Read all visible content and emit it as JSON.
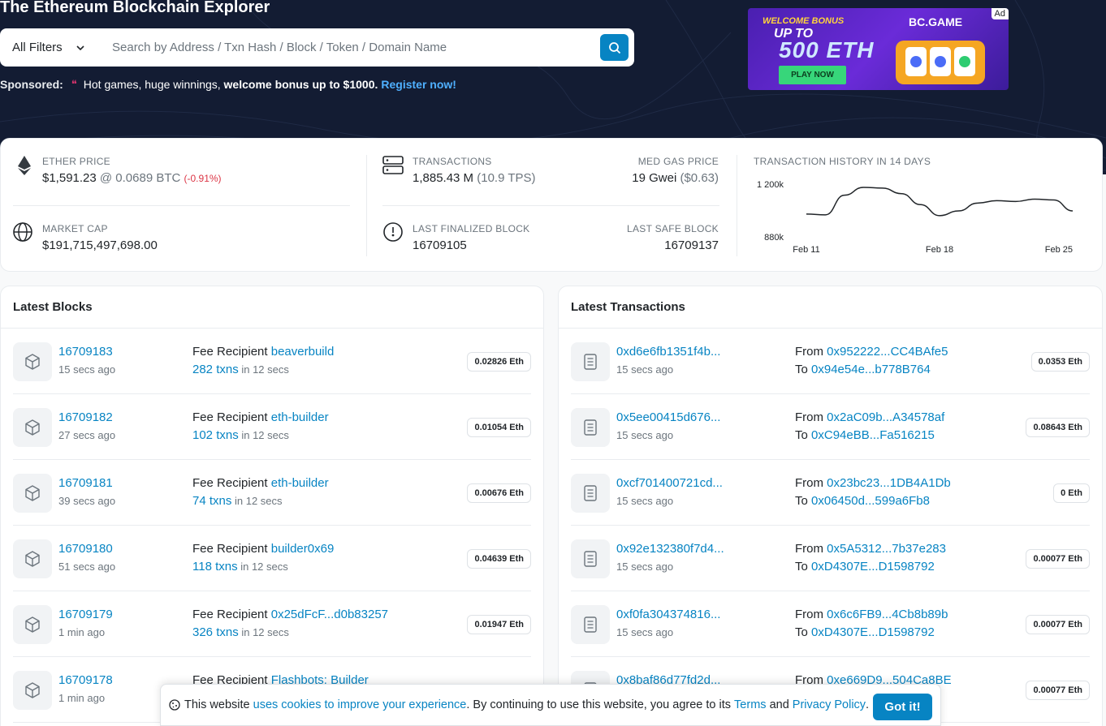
{
  "header": {
    "title": "The Ethereum Blockchain Explorer"
  },
  "search": {
    "filter_label": "All Filters",
    "placeholder": "Search by Address / Txn Hash / Block / Token / Domain Name"
  },
  "sponsored": {
    "label": "Sponsored:",
    "text": "Hot games, huge winnings,",
    "bold": "welcome bonus up to $1000.",
    "link": "Register now!"
  },
  "ad": {
    "line1": "WELCOME BONUS",
    "line2": "UP TO",
    "line3": "500 ETH",
    "cta": "PLAY NOW",
    "brand": "BC.GAME",
    "tag": "Ad"
  },
  "stats": {
    "ether_price": {
      "label": "ETHER PRICE",
      "usd": "$1,591.23",
      "sep": " @ ",
      "btc": "0.0689 BTC",
      "change": "(-0.91%)"
    },
    "market_cap": {
      "label": "MARKET CAP",
      "value": "$191,715,497,698.00"
    },
    "transactions": {
      "label": "TRANSACTIONS",
      "value": "1,885.43 M",
      "tps": "(10.9 TPS)"
    },
    "med_gas": {
      "label": "MED GAS PRICE",
      "value": "19 Gwei",
      "usd": "($0.63)"
    },
    "last_finalized": {
      "label": "LAST FINALIZED BLOCK",
      "value": "16709105"
    },
    "last_safe": {
      "label": "LAST SAFE BLOCK",
      "value": "16709137"
    },
    "history": {
      "label": "TRANSACTION HISTORY IN 14 DAYS"
    }
  },
  "chart_data": {
    "type": "line",
    "title": "TRANSACTION HISTORY IN 14 DAYS",
    "x": [
      "Feb 11",
      "Feb 12",
      "Feb 13",
      "Feb 14",
      "Feb 15",
      "Feb 16",
      "Feb 17",
      "Feb 18",
      "Feb 19",
      "Feb 20",
      "Feb 21",
      "Feb 22",
      "Feb 23",
      "Feb 24",
      "Feb 25"
    ],
    "values": [
      1020,
      1015,
      1140,
      1190,
      1185,
      1150,
      1080,
      1010,
      1040,
      1090,
      1105,
      1100,
      1115,
      1110,
      1040
    ],
    "ytick_labels": [
      "1 200k",
      "880k"
    ],
    "ylim": [
      880,
      1200
    ],
    "xtick_labels": [
      "Feb 11",
      "Feb 18",
      "Feb 25"
    ],
    "grid": false
  },
  "latest_blocks": {
    "title": "Latest Blocks",
    "fee_label": "Fee Recipient",
    "rows": [
      {
        "block": "16709183",
        "age": "15 secs ago",
        "recipient": "beaverbuild",
        "txns": "282 txns",
        "time": "in 12 secs",
        "reward": "0.02826 Eth"
      },
      {
        "block": "16709182",
        "age": "27 secs ago",
        "recipient": "eth-builder",
        "txns": "102 txns",
        "time": "in 12 secs",
        "reward": "0.01054 Eth"
      },
      {
        "block": "16709181",
        "age": "39 secs ago",
        "recipient": "eth-builder",
        "txns": "74 txns",
        "time": "in 12 secs",
        "reward": "0.00676 Eth"
      },
      {
        "block": "16709180",
        "age": "51 secs ago",
        "recipient": "builder0x69",
        "txns": "118 txns",
        "time": "in 12 secs",
        "reward": "0.04639 Eth"
      },
      {
        "block": "16709179",
        "age": "1 min ago",
        "recipient": "0x25dFcF...d0b83257",
        "txns": "326 txns",
        "time": "in 12 secs",
        "reward": "0.01947 Eth"
      },
      {
        "block": "16709178",
        "age": "1 min ago",
        "recipient": "Flashbots: Builder",
        "txns": "",
        "time": "",
        "reward": ""
      }
    ]
  },
  "latest_transactions": {
    "title": "Latest Transactions",
    "from_label": "From",
    "to_label": "To",
    "rows": [
      {
        "hash": "0xd6e6fb1351f4b...",
        "age": "15 secs ago",
        "from": "0x952222...CC4BAfe5",
        "to": "0x94e54e...b778B764",
        "amount": "0.0353 Eth"
      },
      {
        "hash": "0x5ee00415d676...",
        "age": "15 secs ago",
        "from": "0x2aC09b...A34578af",
        "to": "0xC94eBB...Fa516215",
        "amount": "0.08643 Eth"
      },
      {
        "hash": "0xcf701400721cd...",
        "age": "15 secs ago",
        "from": "0x23bc23...1DB4A1Db",
        "to": "0x06450d...599a6Fb8",
        "amount": "0 Eth"
      },
      {
        "hash": "0x92e132380f7d4...",
        "age": "15 secs ago",
        "from": "0x5A5312...7b37e283",
        "to": "0xD4307E...D1598792",
        "amount": "0.00077 Eth"
      },
      {
        "hash": "0xf0fa304374816...",
        "age": "15 secs ago",
        "from": "0x6c6FB9...4Cb8b89b",
        "to": "0xD4307E...D1598792",
        "amount": "0.00077 Eth"
      },
      {
        "hash": "0x8baf86d77fd2d...",
        "age": "",
        "from": "0xe669D9...504Ca8BE",
        "to": "",
        "amount": "0.00077 Eth"
      }
    ]
  },
  "cookie": {
    "text1": "This website",
    "link1": "uses cookies to improve your experience",
    "text2": ". By continuing to use this website, you agree to its",
    "terms": "Terms",
    "and": "and",
    "privacy": "Privacy Policy",
    "dot": ".",
    "button": "Got it!"
  }
}
